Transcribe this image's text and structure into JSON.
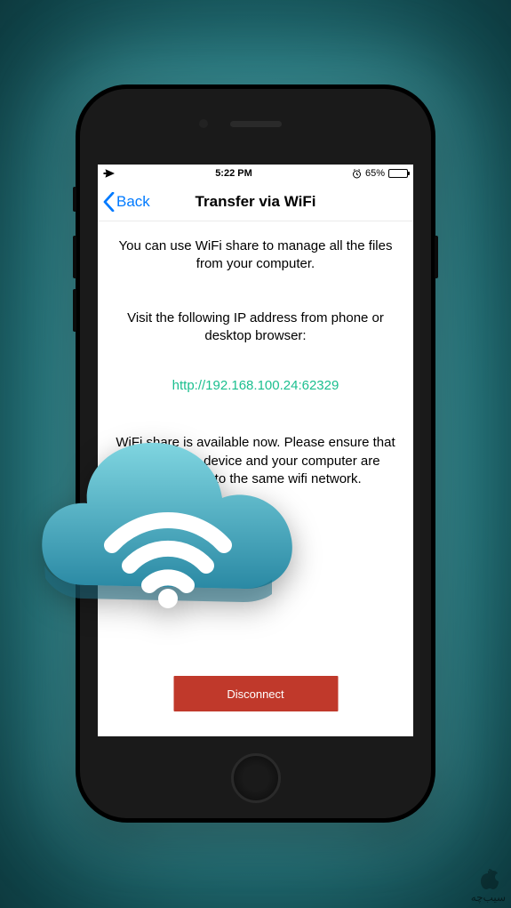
{
  "status_bar": {
    "time": "5:22 PM",
    "battery_text": "65%",
    "battery_level_pct": 65
  },
  "nav": {
    "back_label": "Back",
    "title": "Transfer via WiFi"
  },
  "content": {
    "intro": "You can use WiFi share to manage all the files from your computer.",
    "visit_prompt": "Visit the following IP address from phone or desktop browser:",
    "url": "http://192.168.100.24:62329",
    "note": "WiFi share is available now. Please ensure that your mobile device and your computer are connected to the same wifi network."
  },
  "buttons": {
    "disconnect": "Disconnect"
  },
  "watermark": {
    "text": "سیب‌چه"
  },
  "colors": {
    "ios_blue": "#007aff",
    "link_green": "#1bbf8f",
    "button_red": "#c0392b",
    "cloud_top": "#6fc9d6",
    "cloud_bottom": "#2e8fa8"
  }
}
